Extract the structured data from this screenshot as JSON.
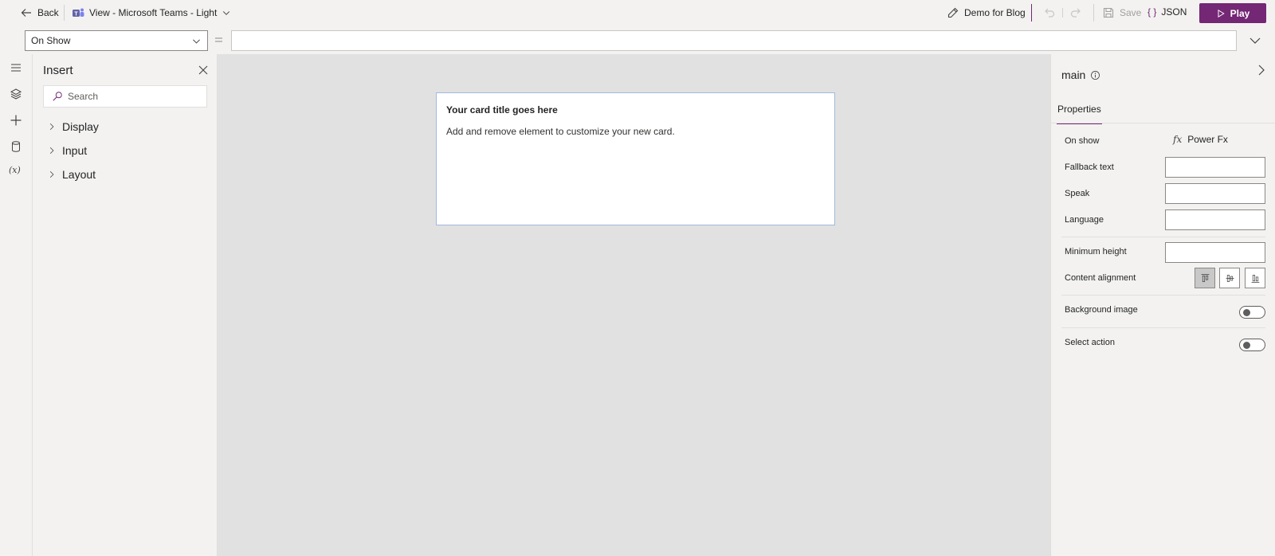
{
  "topbar": {
    "back_label": "Back",
    "view_label": "View - Microsoft Teams - Light",
    "project_label": "Demo for Blog",
    "save_label": "Save",
    "json_label": "JSON",
    "play_label": "Play"
  },
  "formula_bar": {
    "property_value": "On Show",
    "equals": "=",
    "formula_value": ""
  },
  "insert_panel": {
    "title": "Insert",
    "search_placeholder": "Search",
    "items": [
      {
        "label": "Display"
      },
      {
        "label": "Input"
      },
      {
        "label": "Layout"
      }
    ]
  },
  "card": {
    "title": "Your card title goes here",
    "body": "Add and remove element to customize your new card."
  },
  "properties_panel": {
    "element_name": "main",
    "tab_label": "Properties",
    "on_show_label": "On show",
    "power_fx_label": "Power Fx",
    "fallback_text_label": "Fallback text",
    "speak_label": "Speak",
    "language_label": "Language",
    "minimum_height_label": "Minimum height",
    "content_alignment_label": "Content alignment",
    "background_image_label": "Background image",
    "select_action_label": "Select action"
  },
  "colors": {
    "accent": "#742774",
    "canvas": "#e1e1e1",
    "chrome": "#f3f2f1"
  }
}
